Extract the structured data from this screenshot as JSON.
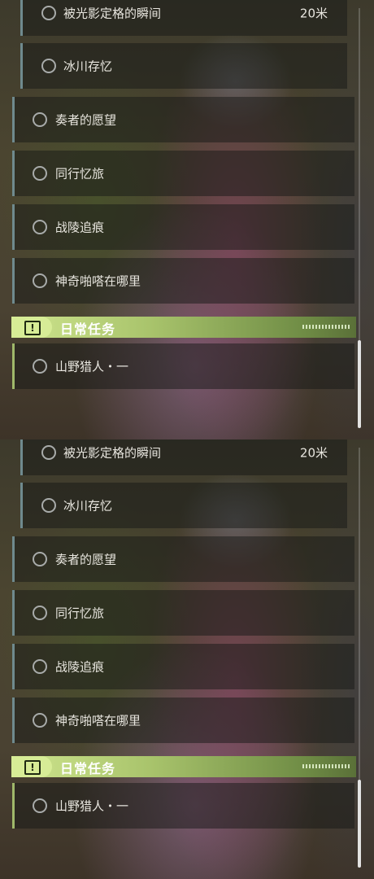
{
  "panels": [
    {
      "quests": {
        "sub_items": [
          {
            "label": "被光影定格的瞬间",
            "distance": "20米"
          },
          {
            "label": "冰川存忆"
          }
        ],
        "main_items": [
          {
            "label": "奏者的愿望"
          },
          {
            "label": "同行忆旅"
          },
          {
            "label": "战陵追痕"
          },
          {
            "label": "神奇啪嗒在哪里"
          }
        ],
        "daily_header": {
          "title": "日常任务",
          "icon": "alert-icon"
        },
        "daily_items": [
          {
            "label": "山野猎人・一"
          }
        ]
      }
    },
    {
      "quests": {
        "sub_items": [
          {
            "label": "被光影定格的瞬间",
            "distance": "20米"
          },
          {
            "label": "冰川存忆"
          }
        ],
        "main_items": [
          {
            "label": "奏者的愿望"
          },
          {
            "label": "同行忆旅"
          },
          {
            "label": "战陵追痕"
          },
          {
            "label": "神奇啪嗒在哪里"
          }
        ],
        "daily_header": {
          "title": "日常任务",
          "icon": "alert-icon"
        },
        "daily_items": [
          {
            "label": "山野猎人・一"
          }
        ]
      }
    }
  ],
  "colors": {
    "daily_accent": "#cfe58e",
    "row_accent": "#6f8a8e"
  }
}
